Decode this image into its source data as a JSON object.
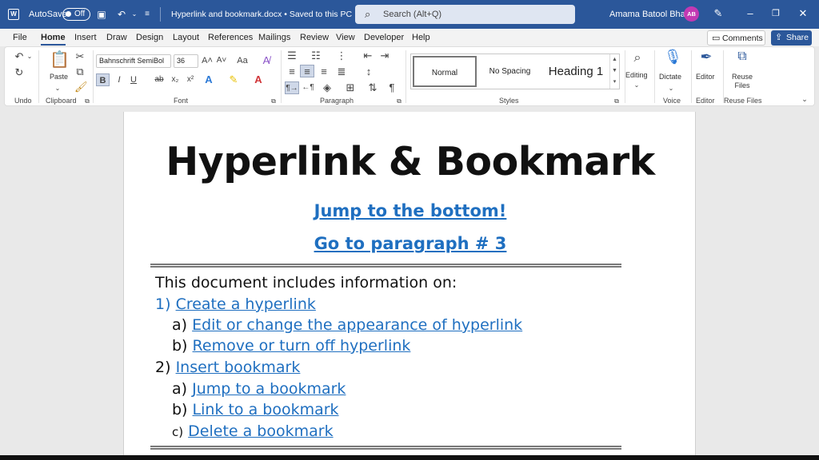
{
  "titlebar": {
    "autosave_label": "AutoSave",
    "autosave_state": "Off",
    "doc_title": "Hyperlink and bookmark.docx • Saved to this PC ⌄",
    "search_placeholder": "Search (Alt+Q)",
    "user_name": "Amama Batool Bhatti",
    "user_initials": "AB",
    "accent_color": "#2b579a"
  },
  "menu": {
    "tabs": [
      "File",
      "Home",
      "Insert",
      "Draw",
      "Design",
      "Layout",
      "References",
      "Mailings",
      "Review",
      "View",
      "Developer",
      "Help"
    ],
    "active_tab": "Home",
    "comments_label": "Comments",
    "share_label": "Share"
  },
  "ribbon": {
    "undo_group": "Undo",
    "clipboard_group": "Clipboard",
    "paste_label": "Paste",
    "font_group": "Font",
    "font_name": "Bahnschrift SemiBol",
    "font_size": "36",
    "paragraph_group": "Paragraph",
    "styles_group": "Styles",
    "styles": [
      "Normal",
      "No Spacing",
      "Heading 1"
    ],
    "editing_label": "Editing",
    "dictate_label": "Dictate",
    "voice_group": "Voice",
    "editor_label": "Editor",
    "editor_group": "Editor",
    "reuse_label": "Reuse Files",
    "reuse_group": "Reuse Files"
  },
  "document": {
    "heading": "Hyperlink & Bookmark",
    "link_bottom": "Jump to the bottom!",
    "link_para": "Go to paragraph # 3",
    "intro": "This document includes information on:",
    "items": [
      {
        "num": "1)",
        "text": "Create a hyperlink"
      },
      {
        "num": "a)",
        "text": "Edit or change the appearance of hyperlink"
      },
      {
        "num": "b)",
        "text": "Remove or turn off hyperlink"
      },
      {
        "num": "2)",
        "text": "Insert bookmark"
      },
      {
        "num": "a)",
        "text": "Jump to a bookmark"
      },
      {
        "num": "b)",
        "text": "Link to a bookmark"
      },
      {
        "num": "c)",
        "text": "Delete a bookmark"
      }
    ],
    "link_color": "#1f6fc0"
  }
}
